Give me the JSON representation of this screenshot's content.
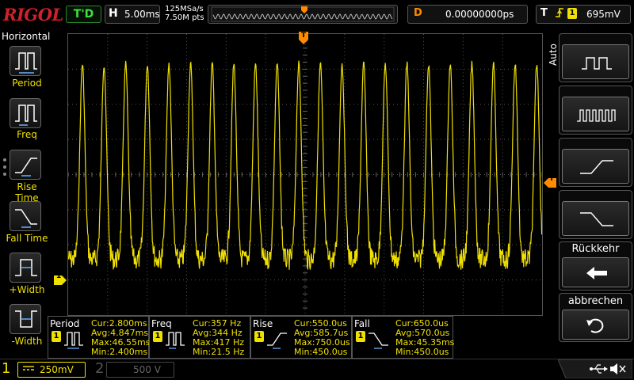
{
  "brand": "RIGOL",
  "top": {
    "trigger_status": "T'D",
    "horizontal_letter": "H",
    "timebase": "5.00ms",
    "sample_rate": "125MSa/s",
    "memory_points": "7.50M pts",
    "delay_letter": "D",
    "delay_value": "0.00000000ps",
    "trigger_letter": "T",
    "trigger_channel": "1",
    "trigger_level": "695mV"
  },
  "left_menu": {
    "title": "Horizontal",
    "items": [
      {
        "label": "Period",
        "icon": "period-icon"
      },
      {
        "label": "Freq",
        "icon": "frequency-icon"
      },
      {
        "label": "Rise Time",
        "icon": "rise-time-icon"
      },
      {
        "label": "Fall Time",
        "icon": "fall-time-icon"
      },
      {
        "label": "+Width",
        "icon": "positive-width-icon"
      },
      {
        "label": "-Width",
        "icon": "negative-width-icon"
      }
    ]
  },
  "right_menu": {
    "mode_label": "Auto",
    "back_label": "Rückkehr",
    "cancel_label": "abbrechen"
  },
  "markers": {
    "trigger_position": "T",
    "trigger_level_marker": "T",
    "channel_ground": "1"
  },
  "measurements": [
    {
      "name": "Period",
      "ch": "1",
      "cur": "Cur:2.800ms",
      "avg": "Avg:4.847ms",
      "max": "Max:46.55ms",
      "min": "Min:2.400ms"
    },
    {
      "name": "Freq",
      "ch": "1",
      "cur": "Cur:357 Hz",
      "avg": "Avg:344 Hz",
      "max": "Max:417 Hz",
      "min": "Min:21.5 Hz"
    },
    {
      "name": "Rise",
      "ch": "1",
      "cur": "Cur:550.0us",
      "avg": "Avg:585.7us",
      "max": "Max:750.0us",
      "min": "Min:450.0us"
    },
    {
      "name": "Fall",
      "ch": "1",
      "cur": "Cur:650.0us",
      "avg": "Avg:570.0us",
      "max": "Max:45.35ms",
      "min": "Min:450.0us"
    }
  ],
  "bottom": {
    "ch1_number": "1",
    "ch1_coupling": "DC",
    "ch1_scale": "250mV",
    "ch2_number": "2",
    "ch2_scale": "500 V"
  },
  "colors": {
    "ch1": "#f0e000",
    "trigger_marker": "#ff8c00",
    "brand": "#d0202a",
    "trigger_status": "#3fe03f"
  }
}
